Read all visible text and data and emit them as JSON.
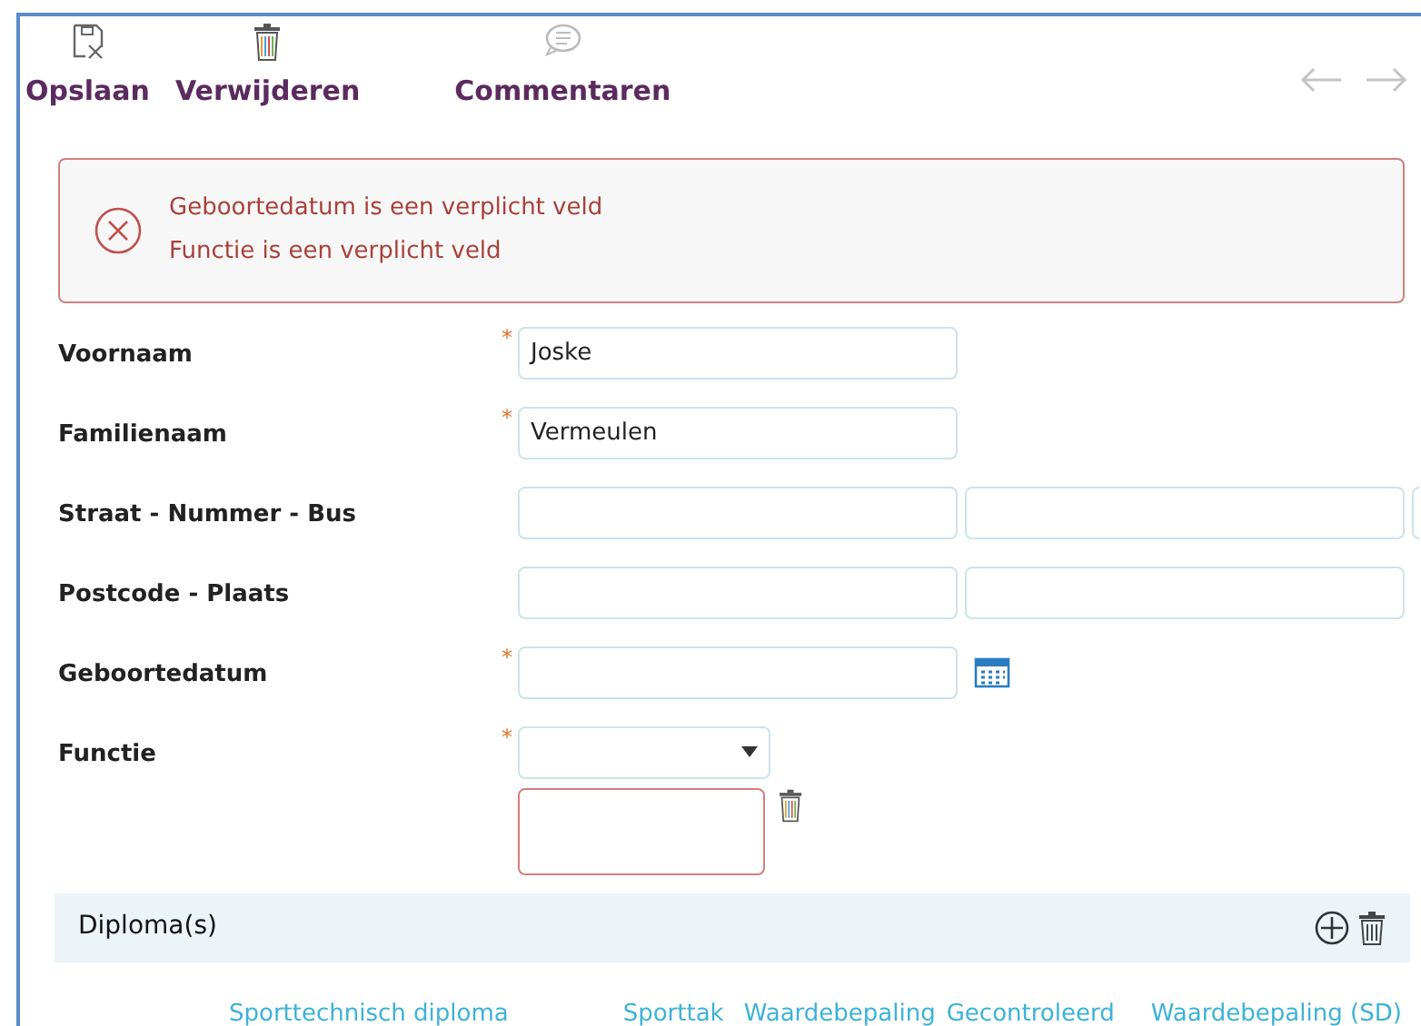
{
  "toolbar": [
    {
      "kind": "save",
      "label": "Opslaan"
    },
    {
      "kind": "delete",
      "label": "Verwijderen"
    },
    {
      "kind": "comments",
      "label": "Commentaren"
    }
  ],
  "navigation": {
    "back_disabled": true,
    "forward_disabled": true
  },
  "errors": [
    "Geboortedatum is een verplicht veld",
    "Functie is een verplicht veld"
  ],
  "fields": [
    {
      "label": "Voornaam",
      "required_mark": "*",
      "inputs": [
        {
          "kind": "text",
          "value": "Joske"
        }
      ]
    },
    {
      "label": "Familienaam",
      "required_mark": "*",
      "inputs": [
        {
          "kind": "text",
          "value": "Vermeulen"
        }
      ]
    },
    {
      "label": "Straat - Nummer - Bus",
      "inputs": [
        {
          "kind": "text"
        },
        {
          "kind": "text"
        },
        {
          "kind": "text"
        }
      ]
    },
    {
      "label": "Postcode - Plaats",
      "inputs": [
        {
          "kind": "text"
        },
        {
          "kind": "text"
        }
      ]
    },
    {
      "label": "Geboortedatum",
      "required_mark": "*",
      "inputs": [
        {
          "kind": "date"
        }
      ]
    },
    {
      "label": "Functie",
      "required_mark": "*",
      "inputs": [
        {
          "kind": "select"
        }
      ],
      "extra": {
        "invalid": true
      }
    }
  ],
  "diplomas": {
    "title": "Diploma(s)",
    "columns": [
      "Sporttechnisch diploma",
      "Sporttak",
      "Waardebepaling",
      "Gecontroleerd",
      "Waardebepaling (SD)"
    ]
  }
}
